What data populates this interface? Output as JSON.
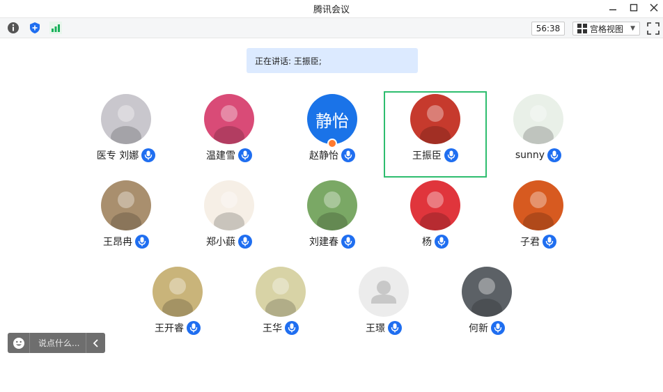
{
  "app": {
    "title": "腾讯会议"
  },
  "toolbar": {
    "timer": "56:38",
    "view_label": "宫格视图"
  },
  "speaking": {
    "text": "正在讲话: 王振臣;"
  },
  "participants": [
    {
      "name": "医专 刘娜",
      "avatar_color": "#c9c7cd",
      "active": false
    },
    {
      "name": "温建雪",
      "avatar_color": "#d94b77",
      "active": false
    },
    {
      "name": "赵静怡",
      "avatar_text": "静怡",
      "avatar_color": "#1a73e8",
      "host": true,
      "active": false
    },
    {
      "name": "王振臣",
      "avatar_color": "#c63a2d",
      "active": true
    },
    {
      "name": "sunny",
      "avatar_color": "#e9f0e8",
      "active": false
    },
    {
      "name": "王昂冉",
      "avatar_color": "#a98f6e",
      "active": false
    },
    {
      "name": "郑小蕻",
      "avatar_color": "#f6efe6",
      "active": false
    },
    {
      "name": "刘建春",
      "avatar_color": "#7aa865",
      "active": false
    },
    {
      "name": "杨",
      "avatar_color": "#e0353c",
      "active": false
    },
    {
      "name": "子君",
      "avatar_color": "#d75a20",
      "active": false
    },
    {
      "name": "王开睿",
      "avatar_color": "#c9b47a",
      "active": false
    },
    {
      "name": "王华",
      "avatar_color": "#d8d3a6",
      "active": false
    },
    {
      "name": "王璟",
      "avatar_color": "#ececec",
      "default_avatar": true,
      "active": false
    },
    {
      "name": "何新",
      "avatar_color": "#5c6166",
      "active": false
    }
  ],
  "chat": {
    "placeholder": "说点什么..."
  },
  "icons": [
    "info-icon",
    "shield-icon",
    "signal-icon",
    "grid-icon",
    "fullscreen-icon",
    "mic-icon",
    "emoji-icon",
    "chevron-left-icon"
  ],
  "colors": {
    "accent": "#1f6ef0",
    "active_border": "#2dbd6e",
    "speaking_bg": "#dceaff"
  }
}
